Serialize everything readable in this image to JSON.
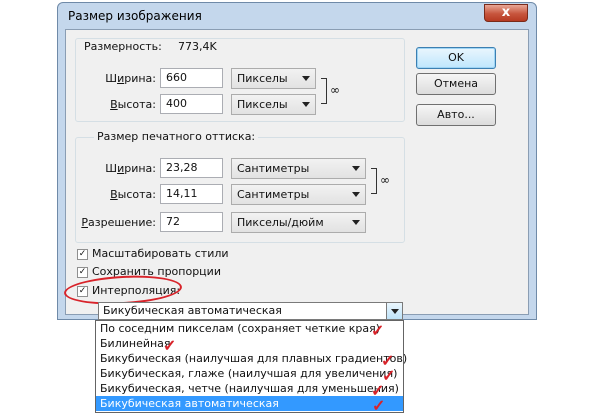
{
  "window": {
    "title": "Размер изображения",
    "close_label": "x"
  },
  "buttons": {
    "ok": "OK",
    "cancel": "Отмена",
    "auto": "Авто..."
  },
  "pixel_dimensions": {
    "label": "Размерность:",
    "size": "773,4K",
    "width_label": "Ширина:",
    "width_value": "660",
    "width_unit": "Пикселы",
    "height_label": "Высота:",
    "height_value": "400",
    "height_unit": "Пикселы"
  },
  "document_size": {
    "legend": "Размер печатного оттиска:",
    "width_label": "Ширина:",
    "width_value": "23,28",
    "width_unit": "Сантиметры",
    "height_label": "Высота:",
    "height_value": "14,11",
    "height_unit": "Сантиметры",
    "resolution_label": "Разрешение:",
    "resolution_value": "72",
    "resolution_unit": "Пикселы/дюйм"
  },
  "options": {
    "scale_styles": {
      "label": "Масштабировать стили",
      "checked": true
    },
    "constrain": {
      "label": "Сохранить пропорции",
      "checked": true
    },
    "resample": {
      "label": "Интерполяция:",
      "checked": true
    }
  },
  "resample_select": {
    "selected": "Бикубическая автоматическая",
    "options": [
      "По соседним пикселам (сохраняет четкие края)",
      "Билинейная",
      "Бикубическая (наилучшая для плавных градиентов)",
      "Бикубическая, глаже (наилучшая для увеличения)",
      "Бикубическая, четче (наилучшая для уменьшения)",
      "Бикубическая автоматическая"
    ],
    "highlighted_index": 5
  },
  "icons": {
    "chain": "link-icon",
    "checkmark": "check-icon",
    "dropdown": "chevron-down-icon"
  },
  "colors": {
    "annotation": "#d8232a",
    "highlight": "#3399ff",
    "frame": "#c4d7ec"
  }
}
